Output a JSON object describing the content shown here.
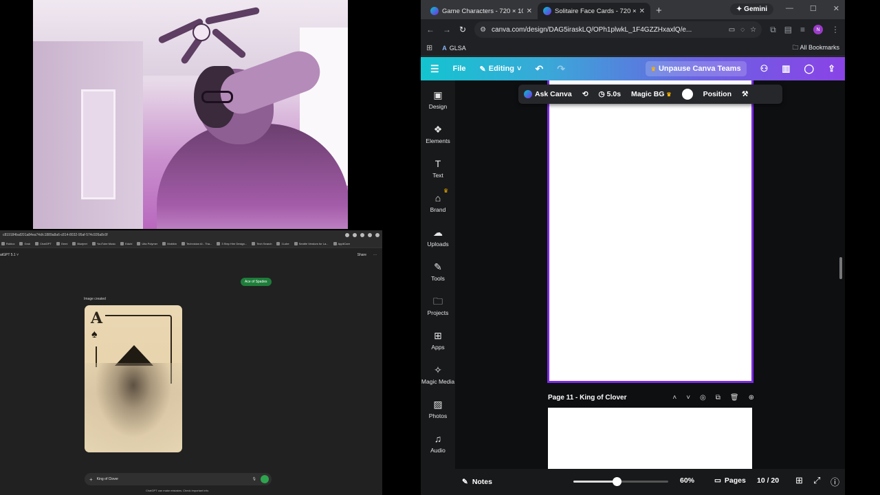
{
  "chrome": {
    "tabs": [
      {
        "title": "Game Characters - 720 × 1080",
        "active": false
      },
      {
        "title": "Solitaire Face Cards - 720 × 1080",
        "active": true
      }
    ],
    "gemini_label": "Gemini",
    "url": "canva.com/design/DAG5iraskLQ/OPh1plwkL_1F4GZZHxaxlQ/e...",
    "profile_initial": "N",
    "bookmarks": [
      {
        "label": "GLSA"
      }
    ],
    "all_bookmarks": "All Bookmarks"
  },
  "canva": {
    "menu_file": "File",
    "menu_editing": "Editing",
    "upgrade_label": "Unpause Canva Teams",
    "sidebar": [
      {
        "label": "Design",
        "icon": "design-icon"
      },
      {
        "label": "Elements",
        "icon": "elements-icon"
      },
      {
        "label": "Text",
        "icon": "text-icon"
      },
      {
        "label": "Brand",
        "icon": "brand-icon"
      },
      {
        "label": "Uploads",
        "icon": "uploads-icon"
      },
      {
        "label": "Tools",
        "icon": "tools-icon"
      },
      {
        "label": "Projects",
        "icon": "projects-icon"
      },
      {
        "label": "Apps",
        "icon": "apps-icon"
      },
      {
        "label": "Magic Media",
        "icon": "magic-media-icon"
      },
      {
        "label": "Photos",
        "icon": "photos-icon"
      },
      {
        "label": "Audio",
        "icon": "audio-icon"
      }
    ],
    "context_toolbar": {
      "ask": "Ask Canva",
      "duration": "5.0s",
      "magic_bg": "Magic BG",
      "position": "Position"
    },
    "page_label": "Page 11 - King of Clover",
    "footer": {
      "notes": "Notes",
      "zoom": "60%",
      "zoom_fraction": 0.46,
      "pages": "Pages",
      "page_count": "10 / 20"
    },
    "accent_color": "#7d2ae8"
  },
  "chatgpt": {
    "url": "c819184baf201a84ea74d/c1889a8a6-c814-8032-95af-574c926a8c0f",
    "bookmarks": [
      "Roblox",
      "Grok",
      "ChatGPT",
      "Gemi",
      "Bluejeet",
      "YouTube Music",
      "Edubi",
      "Ulta Polymer",
      "Mobikin",
      "Technician AI - Tha...",
      "3 Step Hire Design...",
      "Tech Search",
      "1Lube",
      "Seattle Vendors for La...",
      "AppliCare"
    ],
    "model": "atGPT 5.1",
    "share": "Share",
    "user_message": "Ace of Spades",
    "image_status": "Image created",
    "card_rank": "A",
    "input_text": "King of Clover",
    "disclaimer": "ChatGPT can make mistakes. Check important info."
  }
}
